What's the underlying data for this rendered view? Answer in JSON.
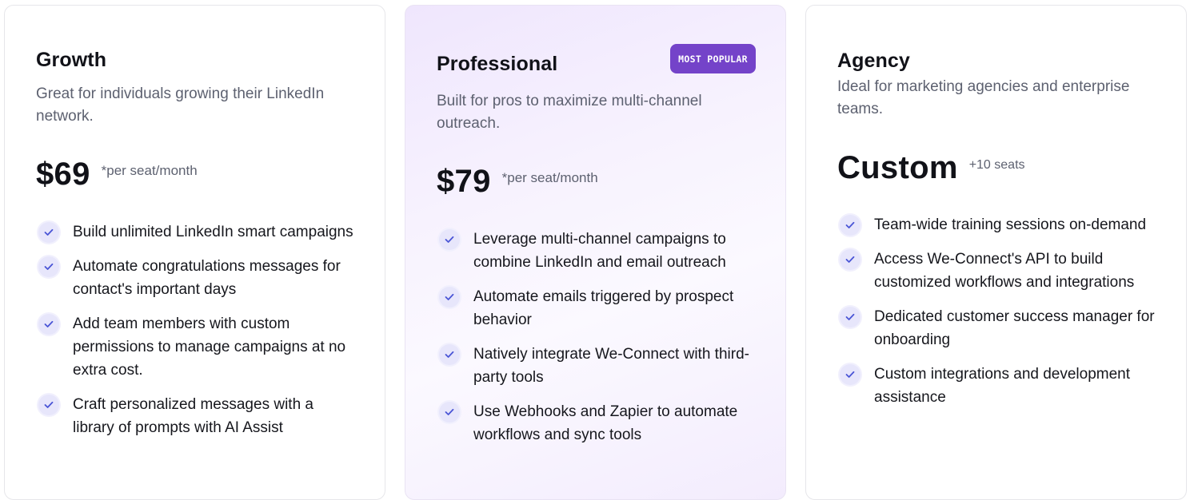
{
  "colors": {
    "accent": "#7443c9",
    "check_bg": "#e7e6fb",
    "check_mark": "#4a55d6",
    "muted_text": "#5d6170"
  },
  "plans": [
    {
      "name": "Growth",
      "description": "Great for individuals growing their LinkedIn network.",
      "price": "$69",
      "price_note": "*per seat/month",
      "features": [
        "Build unlimited LinkedIn smart campaigns",
        "Automate congratulations messages for contact's important days",
        "Add team members with custom permissions to manage campaigns at no extra cost.",
        "Craft personalized messages with a library of prompts with AI Assist"
      ]
    },
    {
      "name": "Professional",
      "badge": "MOST POPULAR",
      "description": "Built for pros to maximize multi-channel outreach.",
      "price": "$79",
      "price_note": "*per seat/month",
      "features": [
        "Leverage multi-channel campaigns to combine LinkedIn and email outreach",
        "Automate emails triggered by prospect behavior",
        "Natively integrate We-Connect with third-party tools",
        "Use Webhooks and Zapier to automate workflows and sync tools"
      ]
    },
    {
      "name": "Agency",
      "description": "Ideal for marketing agencies and enterprise teams.",
      "price": "Custom",
      "price_note": "+10 seats",
      "features": [
        "Team-wide training sessions on-demand",
        "Access We-Connect's API to build customized workflows and integrations",
        "Dedicated customer success manager for onboarding",
        "Custom integrations and development assistance"
      ]
    }
  ]
}
